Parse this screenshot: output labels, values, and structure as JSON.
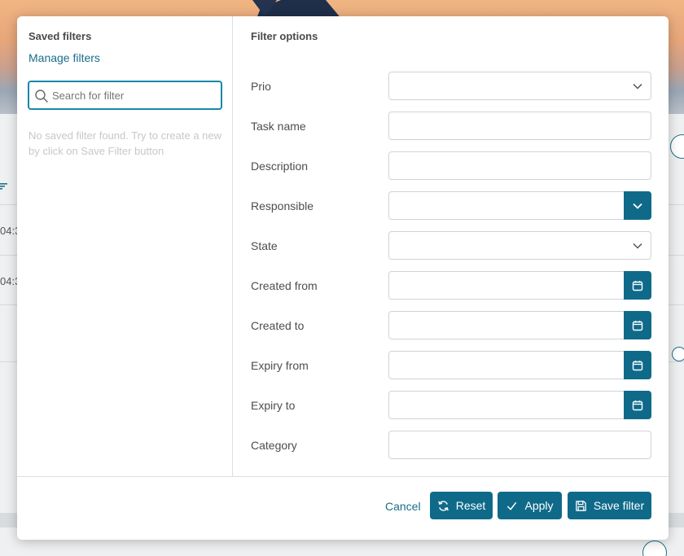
{
  "left_panel": {
    "title": "Saved filters",
    "manage_link": "Manage filters",
    "search_placeholder": "Search for filter",
    "empty_message": "No saved filter found. Try to create a new by click on Save Filter button"
  },
  "right_panel": {
    "title": "Filter options",
    "fields": [
      {
        "label": "Prio",
        "type": "select"
      },
      {
        "label": "Task name",
        "type": "text"
      },
      {
        "label": "Description",
        "type": "text"
      },
      {
        "label": "Responsible",
        "type": "select-button"
      },
      {
        "label": "State",
        "type": "select"
      },
      {
        "label": "Created from",
        "type": "date"
      },
      {
        "label": "Created to",
        "type": "date"
      },
      {
        "label": "Expiry from",
        "type": "date"
      },
      {
        "label": "Expiry to",
        "type": "date"
      },
      {
        "label": "Category",
        "type": "text"
      }
    ]
  },
  "footer": {
    "cancel": "Cancel",
    "reset": "Reset",
    "apply": "Apply",
    "save": "Save filter"
  },
  "background": {
    "row_time_1": "04:3",
    "row_time_2": "04:3"
  },
  "colors": {
    "accent": "#0f6a8a",
    "link": "#1a6d8a",
    "focus_border": "#1788a8"
  }
}
